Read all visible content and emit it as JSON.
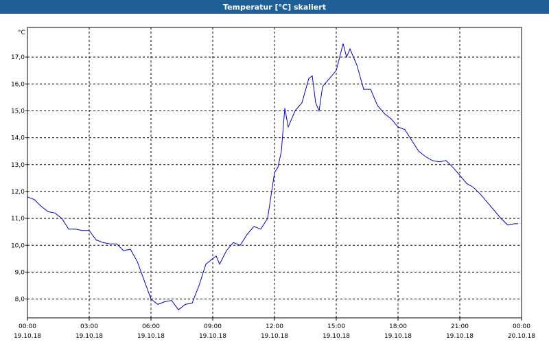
{
  "window": {
    "title": "Temperatur [°C] skaliert"
  },
  "chart_data": {
    "type": "line",
    "title": "Temperatur [°C] skaliert",
    "ylabel": "°C",
    "xlabel": "",
    "grid": true,
    "line_color": "#0000cc",
    "ylim": [
      7.3,
      18.1
    ],
    "xlim": [
      0,
      24
    ],
    "y_ticks": [
      "8,0",
      "9,0",
      "10,0",
      "11,0",
      "12,0",
      "13,0",
      "14,0",
      "15,0",
      "16,0",
      "17,0"
    ],
    "x_ticks": [
      {
        "time": "00:00",
        "date": "19.10.18"
      },
      {
        "time": "03:00",
        "date": "19.10.18"
      },
      {
        "time": "06:00",
        "date": "19.10.18"
      },
      {
        "time": "09:00",
        "date": "19.10.18"
      },
      {
        "time": "12:00",
        "date": "19.10.18"
      },
      {
        "time": "15:00",
        "date": "19.10.18"
      },
      {
        "time": "18:00",
        "date": "19.10.18"
      },
      {
        "time": "21:00",
        "date": "19.10.18"
      },
      {
        "time": "00:00",
        "date": "20.10.18"
      }
    ],
    "series": [
      {
        "x": [
          "19.10.18 00:00",
          "19.10.18 00:20",
          "19.10.18 00:40",
          "19.10.18 01:00",
          "19.10.18 01:20",
          "19.10.18 01:40",
          "19.10.18 02:00",
          "19.10.18 02:20",
          "19.10.18 02:40",
          "19.10.18 03:00",
          "19.10.18 03:20",
          "19.10.18 03:40",
          "19.10.18 04:00",
          "19.10.18 04:20",
          "19.10.18 04:40",
          "19.10.18 05:00",
          "19.10.18 05:20",
          "19.10.18 05:40",
          "19.10.18 06:00",
          "19.10.18 06:20",
          "19.10.18 06:40",
          "19.10.18 07:00",
          "19.10.18 07:20",
          "19.10.18 07:40",
          "19.10.18 08:00",
          "19.10.18 08:20",
          "19.10.18 08:40",
          "19.10.18 09:00",
          "19.10.18 09:10",
          "19.10.18 09:20",
          "19.10.18 09:40",
          "19.10.18 10:00",
          "19.10.18 10:20",
          "19.10.18 10:40",
          "19.10.18 11:00",
          "19.10.18 11:20",
          "19.10.18 11:40",
          "19.10.18 12:00",
          "19.10.18 12:10",
          "19.10.18 12:20",
          "19.10.18 12:30",
          "19.10.18 12:40",
          "19.10.18 13:00",
          "19.10.18 13:20",
          "19.10.18 13:40",
          "19.10.18 13:50",
          "19.10.18 14:00",
          "19.10.18 14:10",
          "19.10.18 14:20",
          "19.10.18 14:40",
          "19.10.18 15:00",
          "19.10.18 15:20",
          "19.10.18 15:30",
          "19.10.18 15:40",
          "19.10.18 15:50",
          "19.10.18 16:00",
          "19.10.18 16:20",
          "19.10.18 16:40",
          "19.10.18 17:00",
          "19.10.18 17:20",
          "19.10.18 17:40",
          "19.10.18 18:00",
          "19.10.18 18:20",
          "19.10.18 18:40",
          "19.10.18 19:00",
          "19.10.18 19:20",
          "19.10.18 19:40",
          "19.10.18 20:00",
          "19.10.18 20:20",
          "19.10.18 20:40",
          "19.10.18 21:00",
          "19.10.18 21:20",
          "19.10.18 21:40",
          "19.10.18 22:00",
          "19.10.18 22:20",
          "19.10.18 22:40",
          "19.10.18 23:00",
          "19.10.18 23:20",
          "19.10.18 23:40",
          "19.10.18 23:50"
        ],
        "y": [
          11.8,
          11.7,
          11.45,
          11.25,
          11.2,
          11.0,
          10.6,
          10.6,
          10.55,
          10.55,
          10.2,
          10.1,
          10.05,
          10.05,
          9.8,
          9.85,
          9.4,
          8.7,
          8.0,
          7.8,
          7.9,
          7.95,
          7.6,
          7.8,
          7.85,
          8.5,
          9.3,
          9.5,
          9.6,
          9.3,
          9.8,
          10.1,
          10.0,
          10.4,
          10.7,
          10.6,
          11.0,
          12.7,
          12.9,
          13.5,
          15.1,
          14.4,
          15.0,
          15.3,
          16.2,
          16.3,
          15.3,
          15.0,
          15.9,
          16.2,
          16.5,
          17.5,
          17.0,
          17.3,
          17.0,
          16.7,
          15.8,
          15.8,
          15.2,
          14.9,
          14.7,
          14.4,
          14.3,
          13.9,
          13.5,
          13.3,
          13.15,
          13.1,
          13.15,
          12.9,
          12.6,
          12.3,
          12.15,
          11.9,
          11.6,
          11.3,
          11.0,
          10.75,
          10.8,
          10.8
        ]
      }
    ]
  }
}
